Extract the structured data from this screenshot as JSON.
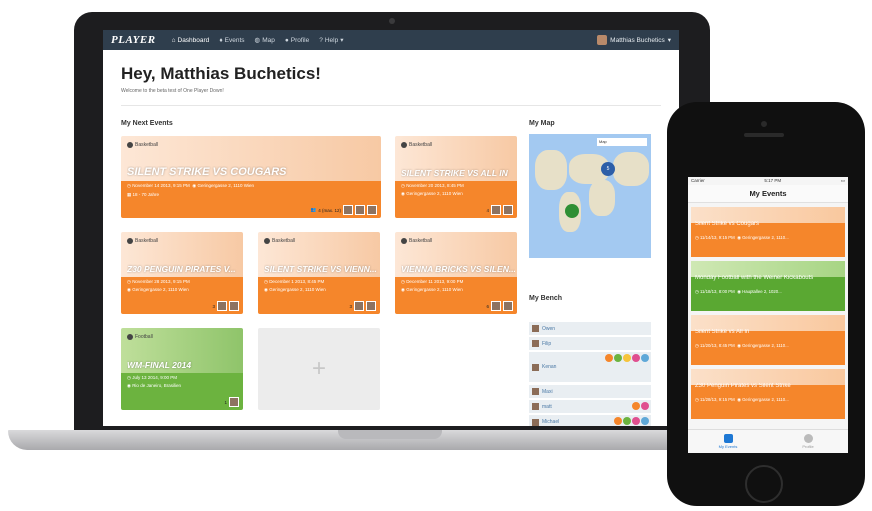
{
  "laptop": {
    "nav": {
      "logo": "PLAYER",
      "items": [
        {
          "label": "Dashboard",
          "active": true
        },
        {
          "label": "Events",
          "active": false
        },
        {
          "label": "Map",
          "active": false
        },
        {
          "label": "Profile",
          "active": false
        },
        {
          "label": "Help",
          "active": false
        }
      ],
      "user": "Matthias Buchetics"
    },
    "greeting": "Hey, Matthias Buchetics!",
    "welcome": "Welcome to the beta test of One Player Down!",
    "next_events_title": "My Next Events",
    "map_title": "My Map",
    "bench_title": "My Bench",
    "map": {
      "type_label": "Map",
      "clusters": [
        {
          "count": "5"
        },
        {
          "count": ""
        }
      ]
    },
    "events": [
      {
        "sport": "Basketball",
        "title": "SILENT STRIKE VS COUGARS",
        "date": "November 14 2013, 9:15 PM",
        "place": "Geringergasse 2, 1110 Wien",
        "extra": "18 - 70 Jahre",
        "count": "4 (max. 12)",
        "green": false
      },
      {
        "sport": "Basketball",
        "title": "SILENT STRIKE VS ALL IN",
        "date": "November 20 2013, 8:45 PM",
        "place": "Geringergasse 2, 1110 Wien",
        "extra": "",
        "count": "4",
        "green": false
      },
      {
        "sport": "Basketball",
        "title": "Z30 PENGUIN PIRATES V...",
        "date": "November 28 2013, 9:15 PM",
        "place": "Geringergasse 2, 1110 Wien",
        "extra": "",
        "count": "3",
        "green": false
      },
      {
        "sport": "Basketball",
        "title": "SILENT STRIKE VS VIENN...",
        "date": "December 1 2013, 8:45 PM",
        "place": "Geringergasse 2, 1110 Wien",
        "extra": "",
        "count": "3",
        "green": false
      },
      {
        "sport": "Basketball",
        "title": "VIENNA BRICKS VS SILEN...",
        "date": "December 11 2013, 9:00 PM",
        "place": "Geringergasse 2, 1110 Wien",
        "extra": "",
        "count": "6",
        "green": false
      },
      {
        "sport": "Football",
        "title": "WM-FINAL 2014",
        "date": "July 13 2014, 9:00 PM",
        "place": "Rio de Janeiro, Brasilien",
        "extra": "",
        "count": "1",
        "green": true
      }
    ],
    "add_label": "+",
    "bench": [
      {
        "name": "Owen"
      },
      {
        "name": "Filip"
      },
      {
        "name": "Kenan"
      },
      {
        "name": "Maxi"
      },
      {
        "name": "matt"
      },
      {
        "name": "Michael"
      }
    ]
  },
  "phone": {
    "carrier": "Carrier",
    "time": "5:17 PM",
    "title": "My Events",
    "events": [
      {
        "name": "Silent Strike vs Cougars",
        "date": "11/14/13, 9:15 PM",
        "place": "Geringergasse 2, 1110...",
        "green": false
      },
      {
        "name": "Monday Football with the Weiner Kickabouts",
        "date": "11/18/13, 8:00 PM",
        "place": "Hauptallee 2, 1020...",
        "green": true
      },
      {
        "name": "Silent Strike vs All In",
        "date": "11/20/13, 8:45 PM",
        "place": "Geringergasse 2, 1110...",
        "green": false
      },
      {
        "name": "Z30 Penguin Pirates vs Silent Strike",
        "date": "11/28/13, 9:15 PM",
        "place": "Geringergasse 2, 1110...",
        "green": false
      }
    ],
    "tabs": [
      {
        "label": "My Events"
      },
      {
        "label": "Profile"
      }
    ]
  },
  "colors": {
    "nav": "#2f3e4d",
    "orange": "#f5862b",
    "green": "#6cb33f",
    "link": "#4a78a5"
  }
}
